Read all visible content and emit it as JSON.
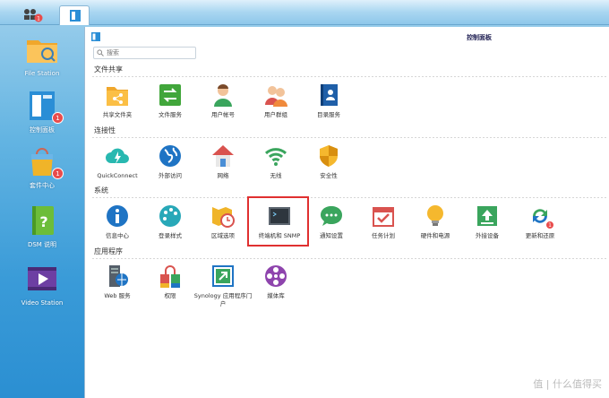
{
  "taskbar": {
    "main_badge": "1"
  },
  "desktop": [
    {
      "id": "file-station",
      "label": "File Station",
      "badge": ""
    },
    {
      "id": "control-panel",
      "label": "控制面板",
      "badge": "1"
    },
    {
      "id": "package-center",
      "label": "套件中心",
      "badge": "1"
    },
    {
      "id": "dsm-help",
      "label": "DSM 说明",
      "badge": ""
    },
    {
      "id": "video-station",
      "label": "Video Station",
      "badge": ""
    }
  ],
  "window": {
    "title": "控制面板",
    "search_placeholder": "搜索"
  },
  "sections": {
    "file_sharing": {
      "title": "文件共享",
      "items": [
        "共享文件夹",
        "文件服务",
        "用户帐号",
        "用户群组",
        "目录服务"
      ]
    },
    "connectivity": {
      "title": "连接性",
      "items": [
        "QuickConnect",
        "外部访问",
        "网络",
        "无线",
        "安全性"
      ]
    },
    "system": {
      "title": "系统",
      "items": [
        "信息中心",
        "登录样式",
        "区域选项",
        "终端机和 SNMP",
        "通知设置",
        "任务计划",
        "硬件和电源",
        "外接设备",
        "更新和还原"
      ],
      "update_badge": "1"
    },
    "apps": {
      "title": "应用程序",
      "items": [
        "Web 服务",
        "权限",
        "Synology 应用程序门户",
        "媒体库"
      ]
    }
  },
  "watermark": "值 | 什么值得买",
  "colors": {
    "highlight": "#e03030",
    "badge": "#e94c4c"
  }
}
